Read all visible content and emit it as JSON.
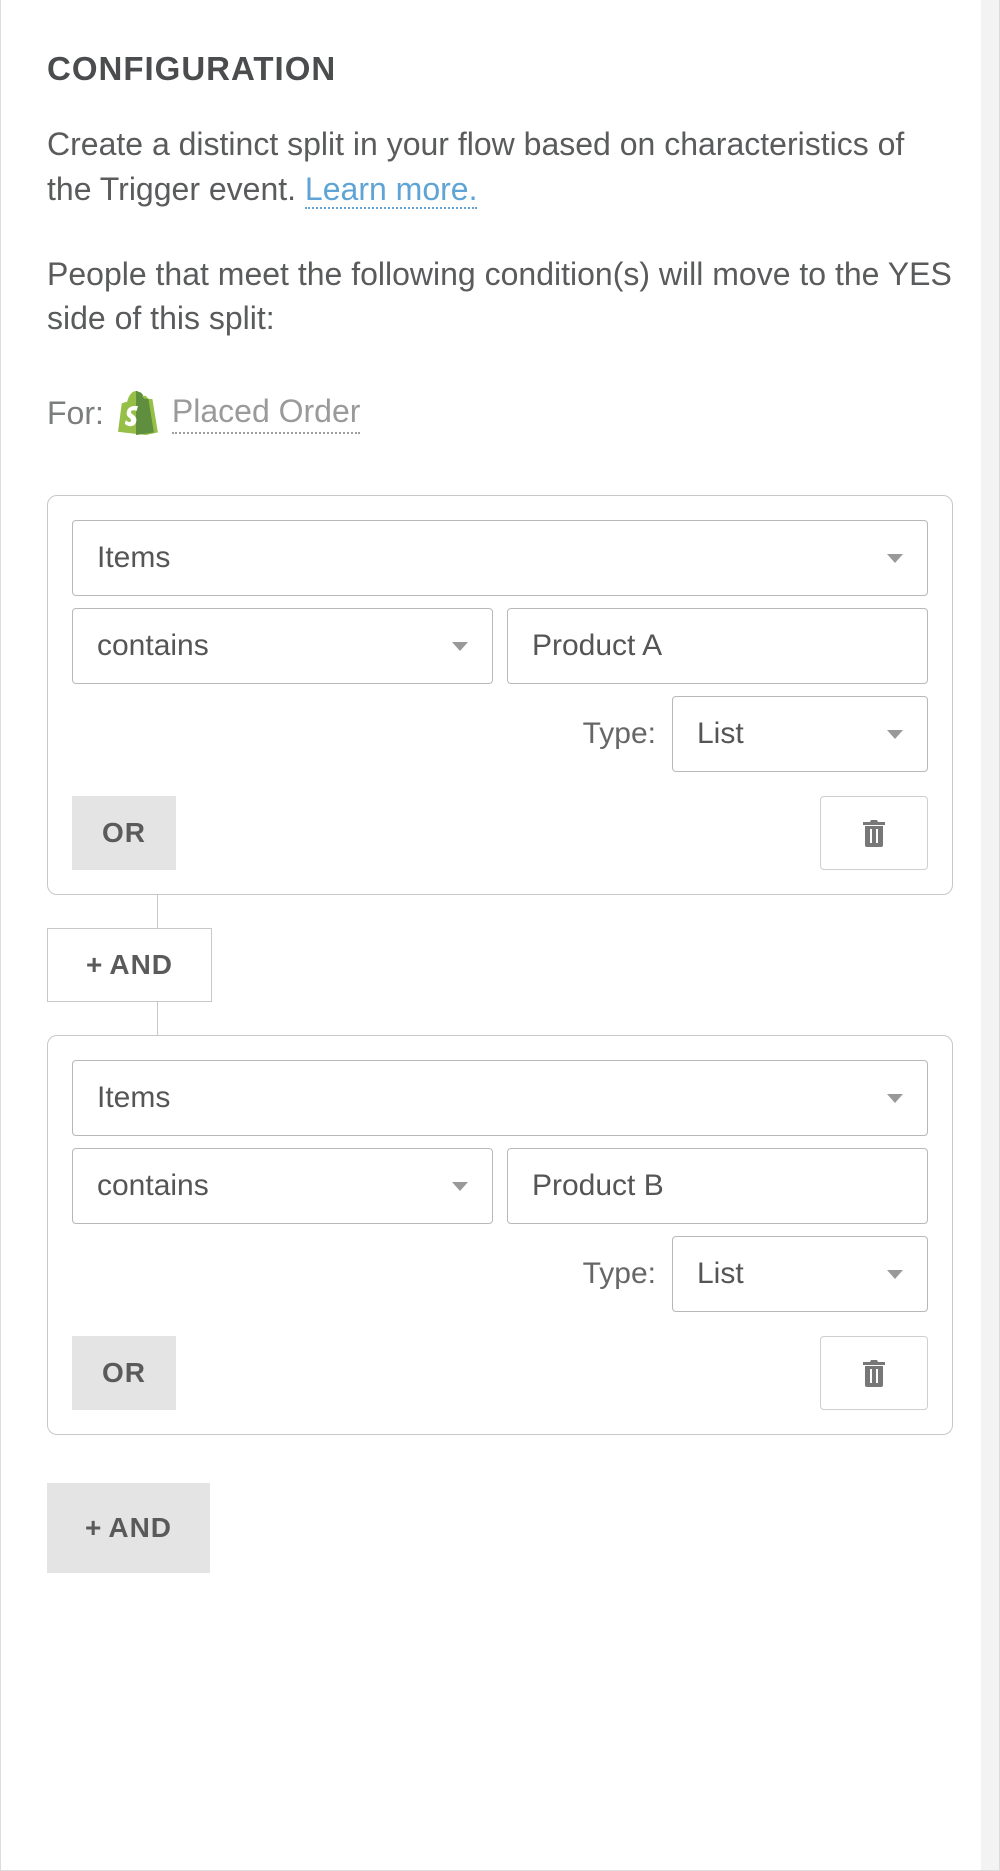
{
  "header": {
    "title": "CONFIGURATION",
    "description_prefix": "Create a distinct split in your flow based on characteristics of the Trigger event. ",
    "learn_more": "Learn more.",
    "condition_text": "People that meet the following condition(s) will move to the YES side of this split:",
    "for_label": "For:",
    "event_name": "Placed Order"
  },
  "labels": {
    "type": "Type:",
    "or": "OR",
    "and": "AND"
  },
  "groups": [
    {
      "dimension": "Items",
      "operator": "contains",
      "value": "Product A",
      "type": "List"
    },
    {
      "dimension": "Items",
      "operator": "contains",
      "value": "Product B",
      "type": "List"
    }
  ]
}
